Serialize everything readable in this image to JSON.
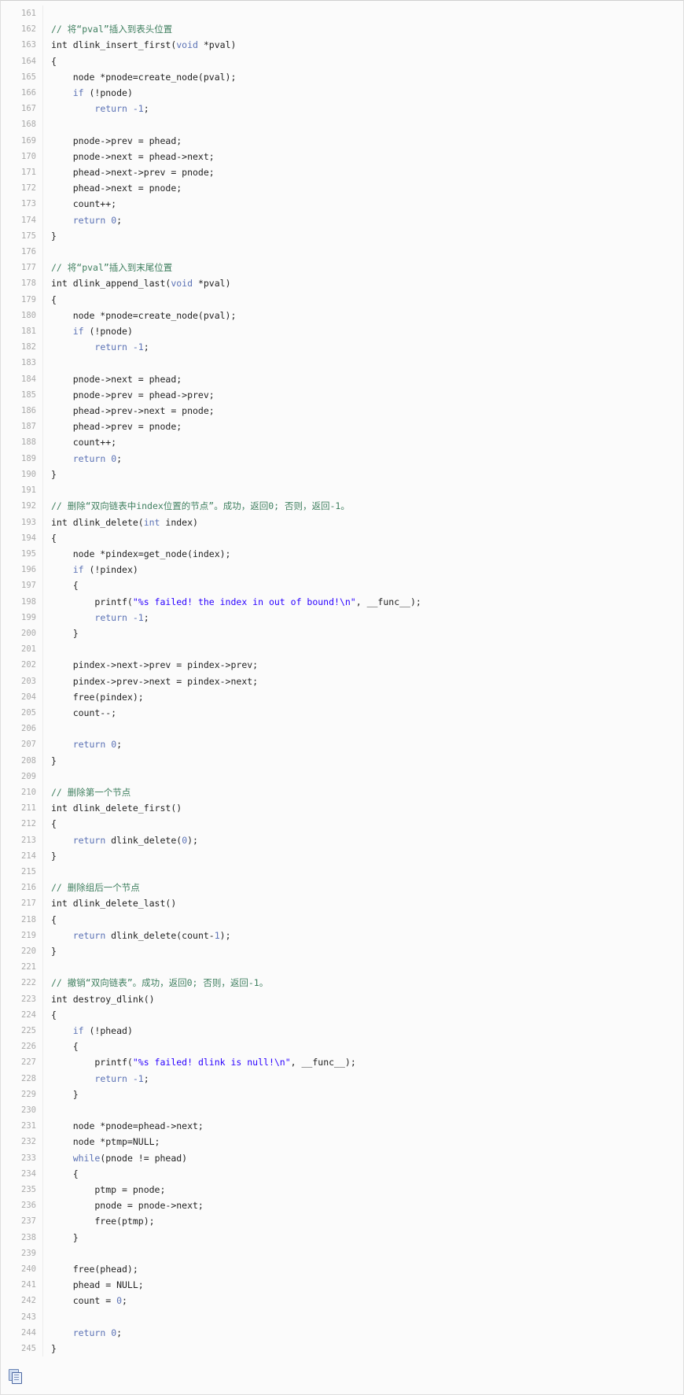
{
  "viewer": {
    "language": "C",
    "first_line": 161,
    "last_line": 245,
    "copy_button_label": "copy"
  },
  "colors": {
    "background": "#fbfbfb",
    "border": "#dfdfdf",
    "gutter_text": "#a9a9a9",
    "comment": "#3f7f5f",
    "keyword": "#5b72b5",
    "string": "#2a00ff",
    "number": "#5b72b5",
    "plain": "#222222"
  },
  "code": {
    "lines": [
      {
        "n": 161,
        "tokens": []
      },
      {
        "n": 162,
        "tokens": [
          {
            "t": "cmt",
            "s": "// 将“pval”插入到表头位置"
          }
        ]
      },
      {
        "n": 163,
        "tokens": [
          {
            "t": "plain",
            "s": "int dlink_insert_first("
          },
          {
            "t": "kw2",
            "s": "void"
          },
          {
            "t": "plain",
            "s": " *pval)"
          }
        ]
      },
      {
        "n": 164,
        "tokens": [
          {
            "t": "plain",
            "s": "{"
          }
        ]
      },
      {
        "n": 165,
        "tokens": [
          {
            "t": "plain",
            "s": "    node *pnode=create_node(pval);"
          }
        ]
      },
      {
        "n": 166,
        "tokens": [
          {
            "t": "plain",
            "s": "    "
          },
          {
            "t": "kw2",
            "s": "if"
          },
          {
            "t": "plain",
            "s": " (!pnode)"
          }
        ]
      },
      {
        "n": 167,
        "tokens": [
          {
            "t": "plain",
            "s": "        "
          },
          {
            "t": "kw2",
            "s": "return"
          },
          {
            "t": "plain",
            "s": " "
          },
          {
            "t": "num",
            "s": "-1"
          },
          {
            "t": "plain",
            "s": ";"
          }
        ]
      },
      {
        "n": 168,
        "tokens": []
      },
      {
        "n": 169,
        "tokens": [
          {
            "t": "plain",
            "s": "    pnode->prev = phead;"
          }
        ]
      },
      {
        "n": 170,
        "tokens": [
          {
            "t": "plain",
            "s": "    pnode->next = phead->next;"
          }
        ]
      },
      {
        "n": 171,
        "tokens": [
          {
            "t": "plain",
            "s": "    phead->next->prev = pnode;"
          }
        ]
      },
      {
        "n": 172,
        "tokens": [
          {
            "t": "plain",
            "s": "    phead->next = pnode;"
          }
        ]
      },
      {
        "n": 173,
        "tokens": [
          {
            "t": "plain",
            "s": "    count++;"
          }
        ]
      },
      {
        "n": 174,
        "tokens": [
          {
            "t": "plain",
            "s": "    "
          },
          {
            "t": "kw2",
            "s": "return"
          },
          {
            "t": "plain",
            "s": " "
          },
          {
            "t": "num",
            "s": "0"
          },
          {
            "t": "plain",
            "s": ";"
          }
        ]
      },
      {
        "n": 175,
        "tokens": [
          {
            "t": "plain",
            "s": "}"
          }
        ]
      },
      {
        "n": 176,
        "tokens": []
      },
      {
        "n": 177,
        "tokens": [
          {
            "t": "cmt",
            "s": "// 将“pval”插入到末尾位置"
          }
        ]
      },
      {
        "n": 178,
        "tokens": [
          {
            "t": "plain",
            "s": "int dlink_append_last("
          },
          {
            "t": "kw2",
            "s": "void"
          },
          {
            "t": "plain",
            "s": " *pval)"
          }
        ]
      },
      {
        "n": 179,
        "tokens": [
          {
            "t": "plain",
            "s": "{"
          }
        ]
      },
      {
        "n": 180,
        "tokens": [
          {
            "t": "plain",
            "s": "    node *pnode=create_node(pval);"
          }
        ]
      },
      {
        "n": 181,
        "tokens": [
          {
            "t": "plain",
            "s": "    "
          },
          {
            "t": "kw2",
            "s": "if"
          },
          {
            "t": "plain",
            "s": " (!pnode)"
          }
        ]
      },
      {
        "n": 182,
        "tokens": [
          {
            "t": "plain",
            "s": "        "
          },
          {
            "t": "kw2",
            "s": "return"
          },
          {
            "t": "plain",
            "s": " "
          },
          {
            "t": "num",
            "s": "-1"
          },
          {
            "t": "plain",
            "s": ";"
          }
        ]
      },
      {
        "n": 183,
        "tokens": []
      },
      {
        "n": 184,
        "tokens": [
          {
            "t": "plain",
            "s": "    pnode->next = phead;"
          }
        ]
      },
      {
        "n": 185,
        "tokens": [
          {
            "t": "plain",
            "s": "    pnode->prev = phead->prev;"
          }
        ]
      },
      {
        "n": 186,
        "tokens": [
          {
            "t": "plain",
            "s": "    phead->prev->next = pnode;"
          }
        ]
      },
      {
        "n": 187,
        "tokens": [
          {
            "t": "plain",
            "s": "    phead->prev = pnode;"
          }
        ]
      },
      {
        "n": 188,
        "tokens": [
          {
            "t": "plain",
            "s": "    count++;"
          }
        ]
      },
      {
        "n": 189,
        "tokens": [
          {
            "t": "plain",
            "s": "    "
          },
          {
            "t": "kw2",
            "s": "return"
          },
          {
            "t": "plain",
            "s": " "
          },
          {
            "t": "num",
            "s": "0"
          },
          {
            "t": "plain",
            "s": ";"
          }
        ]
      },
      {
        "n": 190,
        "tokens": [
          {
            "t": "plain",
            "s": "}"
          }
        ]
      },
      {
        "n": 191,
        "tokens": []
      },
      {
        "n": 192,
        "tokens": [
          {
            "t": "cmt",
            "s": "// 删除“双向链表中index位置的节点”。成功，返回0; 否则，返回-1。"
          }
        ]
      },
      {
        "n": 193,
        "tokens": [
          {
            "t": "plain",
            "s": "int dlink_delete("
          },
          {
            "t": "kw2",
            "s": "int"
          },
          {
            "t": "plain",
            "s": " index)"
          }
        ]
      },
      {
        "n": 194,
        "tokens": [
          {
            "t": "plain",
            "s": "{"
          }
        ]
      },
      {
        "n": 195,
        "tokens": [
          {
            "t": "plain",
            "s": "    node *pindex=get_node(index);"
          }
        ]
      },
      {
        "n": 196,
        "tokens": [
          {
            "t": "plain",
            "s": "    "
          },
          {
            "t": "kw2",
            "s": "if"
          },
          {
            "t": "plain",
            "s": " (!pindex)"
          }
        ]
      },
      {
        "n": 197,
        "tokens": [
          {
            "t": "plain",
            "s": "    {"
          }
        ]
      },
      {
        "n": 198,
        "tokens": [
          {
            "t": "plain",
            "s": "        printf("
          },
          {
            "t": "str",
            "s": "\"%s failed! the index in out of bound!\\n\""
          },
          {
            "t": "plain",
            "s": ", __func__);"
          }
        ]
      },
      {
        "n": 199,
        "tokens": [
          {
            "t": "plain",
            "s": "        "
          },
          {
            "t": "kw2",
            "s": "return"
          },
          {
            "t": "plain",
            "s": " "
          },
          {
            "t": "num",
            "s": "-1"
          },
          {
            "t": "plain",
            "s": ";"
          }
        ]
      },
      {
        "n": 200,
        "tokens": [
          {
            "t": "plain",
            "s": "    }"
          }
        ]
      },
      {
        "n": 201,
        "tokens": []
      },
      {
        "n": 202,
        "tokens": [
          {
            "t": "plain",
            "s": "    pindex->next->prev = pindex->prev;"
          }
        ]
      },
      {
        "n": 203,
        "tokens": [
          {
            "t": "plain",
            "s": "    pindex->prev->next = pindex->next;"
          }
        ]
      },
      {
        "n": 204,
        "tokens": [
          {
            "t": "plain",
            "s": "    free(pindex);"
          }
        ]
      },
      {
        "n": 205,
        "tokens": [
          {
            "t": "plain",
            "s": "    count--;"
          }
        ]
      },
      {
        "n": 206,
        "tokens": []
      },
      {
        "n": 207,
        "tokens": [
          {
            "t": "plain",
            "s": "    "
          },
          {
            "t": "kw2",
            "s": "return"
          },
          {
            "t": "plain",
            "s": " "
          },
          {
            "t": "num",
            "s": "0"
          },
          {
            "t": "plain",
            "s": ";"
          }
        ]
      },
      {
        "n": 208,
        "tokens": [
          {
            "t": "plain",
            "s": "}"
          }
        ]
      },
      {
        "n": 209,
        "tokens": []
      },
      {
        "n": 210,
        "tokens": [
          {
            "t": "cmt",
            "s": "// 删除第一个节点"
          }
        ]
      },
      {
        "n": 211,
        "tokens": [
          {
            "t": "plain",
            "s": "int dlink_delete_first()"
          }
        ]
      },
      {
        "n": 212,
        "tokens": [
          {
            "t": "plain",
            "s": "{"
          }
        ]
      },
      {
        "n": 213,
        "tokens": [
          {
            "t": "plain",
            "s": "    "
          },
          {
            "t": "kw2",
            "s": "return"
          },
          {
            "t": "plain",
            "s": " dlink_delete("
          },
          {
            "t": "num",
            "s": "0"
          },
          {
            "t": "plain",
            "s": ");"
          }
        ]
      },
      {
        "n": 214,
        "tokens": [
          {
            "t": "plain",
            "s": "}"
          }
        ]
      },
      {
        "n": 215,
        "tokens": []
      },
      {
        "n": 216,
        "tokens": [
          {
            "t": "cmt",
            "s": "// 删除组后一个节点"
          }
        ]
      },
      {
        "n": 217,
        "tokens": [
          {
            "t": "plain",
            "s": "int dlink_delete_last()"
          }
        ]
      },
      {
        "n": 218,
        "tokens": [
          {
            "t": "plain",
            "s": "{"
          }
        ]
      },
      {
        "n": 219,
        "tokens": [
          {
            "t": "plain",
            "s": "    "
          },
          {
            "t": "kw2",
            "s": "return"
          },
          {
            "t": "plain",
            "s": " dlink_delete(count-"
          },
          {
            "t": "num",
            "s": "1"
          },
          {
            "t": "plain",
            "s": ");"
          }
        ]
      },
      {
        "n": 220,
        "tokens": [
          {
            "t": "plain",
            "s": "}"
          }
        ]
      },
      {
        "n": 221,
        "tokens": []
      },
      {
        "n": 222,
        "tokens": [
          {
            "t": "cmt",
            "s": "// 撤销“双向链表”。成功，返回0; 否则，返回-1。"
          }
        ]
      },
      {
        "n": 223,
        "tokens": [
          {
            "t": "plain",
            "s": "int destroy_dlink()"
          }
        ]
      },
      {
        "n": 224,
        "tokens": [
          {
            "t": "plain",
            "s": "{"
          }
        ]
      },
      {
        "n": 225,
        "tokens": [
          {
            "t": "plain",
            "s": "    "
          },
          {
            "t": "kw2",
            "s": "if"
          },
          {
            "t": "plain",
            "s": " (!phead)"
          }
        ]
      },
      {
        "n": 226,
        "tokens": [
          {
            "t": "plain",
            "s": "    {"
          }
        ]
      },
      {
        "n": 227,
        "tokens": [
          {
            "t": "plain",
            "s": "        printf("
          },
          {
            "t": "str",
            "s": "\"%s failed! dlink is null!\\n\""
          },
          {
            "t": "plain",
            "s": ", __func__);"
          }
        ]
      },
      {
        "n": 228,
        "tokens": [
          {
            "t": "plain",
            "s": "        "
          },
          {
            "t": "kw2",
            "s": "return"
          },
          {
            "t": "plain",
            "s": " "
          },
          {
            "t": "num",
            "s": "-1"
          },
          {
            "t": "plain",
            "s": ";"
          }
        ]
      },
      {
        "n": 229,
        "tokens": [
          {
            "t": "plain",
            "s": "    }"
          }
        ]
      },
      {
        "n": 230,
        "tokens": []
      },
      {
        "n": 231,
        "tokens": [
          {
            "t": "plain",
            "s": "    node *pnode=phead->next;"
          }
        ]
      },
      {
        "n": 232,
        "tokens": [
          {
            "t": "plain",
            "s": "    node *ptmp=NULL;"
          }
        ]
      },
      {
        "n": 233,
        "tokens": [
          {
            "t": "plain",
            "s": "    "
          },
          {
            "t": "kw2",
            "s": "while"
          },
          {
            "t": "plain",
            "s": "(pnode != phead)"
          }
        ]
      },
      {
        "n": 234,
        "tokens": [
          {
            "t": "plain",
            "s": "    {"
          }
        ]
      },
      {
        "n": 235,
        "tokens": [
          {
            "t": "plain",
            "s": "        ptmp = pnode;"
          }
        ]
      },
      {
        "n": 236,
        "tokens": [
          {
            "t": "plain",
            "s": "        pnode = pnode->next;"
          }
        ]
      },
      {
        "n": 237,
        "tokens": [
          {
            "t": "plain",
            "s": "        free(ptmp);"
          }
        ]
      },
      {
        "n": 238,
        "tokens": [
          {
            "t": "plain",
            "s": "    }"
          }
        ]
      },
      {
        "n": 239,
        "tokens": []
      },
      {
        "n": 240,
        "tokens": [
          {
            "t": "plain",
            "s": "    free(phead);"
          }
        ]
      },
      {
        "n": 241,
        "tokens": [
          {
            "t": "plain",
            "s": "    phead = NULL;"
          }
        ]
      },
      {
        "n": 242,
        "tokens": [
          {
            "t": "plain",
            "s": "    count = "
          },
          {
            "t": "num",
            "s": "0"
          },
          {
            "t": "plain",
            "s": ";"
          }
        ]
      },
      {
        "n": 243,
        "tokens": []
      },
      {
        "n": 244,
        "tokens": [
          {
            "t": "plain",
            "s": "    "
          },
          {
            "t": "kw2",
            "s": "return"
          },
          {
            "t": "plain",
            "s": " "
          },
          {
            "t": "num",
            "s": "0"
          },
          {
            "t": "plain",
            "s": ";"
          }
        ]
      },
      {
        "n": 245,
        "tokens": [
          {
            "t": "plain",
            "s": "}"
          }
        ]
      }
    ]
  }
}
